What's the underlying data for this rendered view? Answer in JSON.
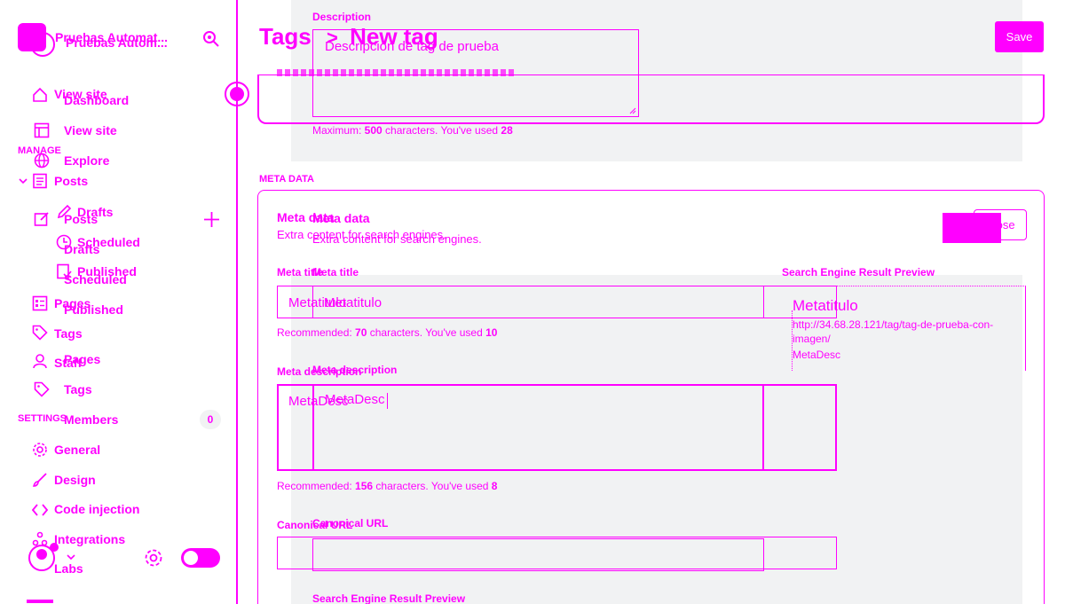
{
  "colors": {
    "accent": "#ff00ff",
    "panel": "#f1f2f3",
    "background": "#ffffff"
  },
  "sidebar": {
    "site_name": "Pruebas Automat...",
    "site_name_ghost": "Pruebas Autom...",
    "nav": {
      "view_site_ghost": "View site",
      "dashboard": "Dashboard",
      "view_site": "View site",
      "manage_header": "MANAGE",
      "explore": "Explore",
      "posts": "Posts",
      "posts_ghost": "Posts",
      "drafts": "Drafts",
      "drafts_ghost": "Drafts",
      "scheduled": "Scheduled",
      "scheduled_ghost": "Scheduled",
      "published": "Published",
      "published_ghost": "Published",
      "pages": "Pages",
      "pages_ghost": "Pages",
      "tags": "Tags",
      "tags_ghost": "Tags",
      "staff": "Staff",
      "settings_header": "SETTINGS",
      "members": "Members",
      "members_count": "0",
      "general": "General",
      "design": "Design",
      "code_injection": "Code injection",
      "integrations": "Integrations",
      "labs": "Labs"
    }
  },
  "header": {
    "breadcrumb_parent": "Tags",
    "breadcrumb_sep": ">",
    "breadcrumb_current": "New tag",
    "save_label": "Save"
  },
  "description": {
    "label": "Description",
    "value": "Descripción de tag de prueba",
    "counter_prefix": "Maximum: ",
    "counter_max": "500",
    "counter_mid": " characters. You've used ",
    "counter_used": "28"
  },
  "meta": {
    "section_header": "META DATA",
    "title": "Meta data",
    "title_ghost": "Meta data",
    "subtitle": "Extra content for search engines.",
    "subtitle_ghost": "Extra content for search engines.",
    "close_label": "Close",
    "meta_title_label": "Meta title",
    "meta_title_label_ghost": "Meta title",
    "meta_title_value": "Metatitulo",
    "meta_title_value_ghost": "Metatitulo",
    "meta_title_counter_prefix": "Recommended: ",
    "meta_title_counter_max": "70",
    "meta_title_counter_mid": " characters. You've used ",
    "meta_title_counter_used": "10",
    "meta_desc_label": "Meta description",
    "meta_desc_label_ghost": "Meta description",
    "meta_desc_value": "MetaDesc",
    "meta_desc_value_ghost": "MetaDesc",
    "meta_desc_counter_prefix": "Recommended: ",
    "meta_desc_counter_max": "156",
    "meta_desc_counter_mid": " characters. You've used ",
    "meta_desc_counter_used": "8",
    "canonical_label": "Canonical URL",
    "canonical_label_ghost": "Canonical URL",
    "serp_title": "Search Engine Result Preview",
    "serp_title_ghost": "Search Engine Result Preview",
    "serp_preview_title": "Metatitulo",
    "serp_preview_url": "http://34.68.28.121/tag/tag-de-prueba-con-imagen/",
    "serp_preview_desc": "MetaDesc"
  }
}
